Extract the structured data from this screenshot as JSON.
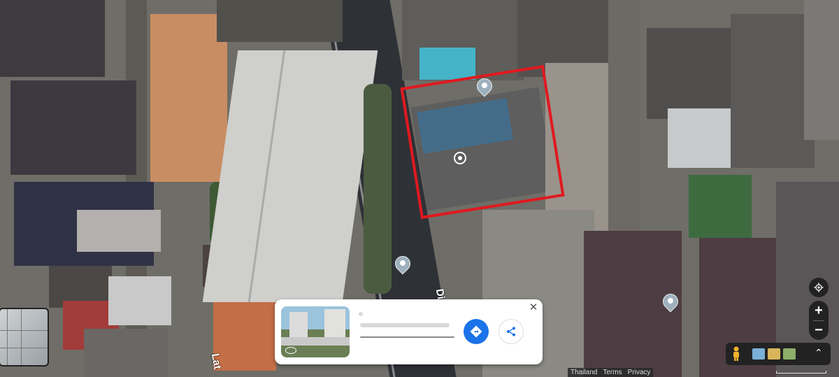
{
  "map": {
    "type": "satellite",
    "accent_color": "#e0191f",
    "road_labels": [
      "Lat",
      "Di"
    ]
  },
  "place_card": {
    "title": "",
    "subtitle": "",
    "directions_icon": "directions-icon",
    "share_icon": "share-icon",
    "close_icon": "close-icon",
    "button_color": "#1a73e8"
  },
  "controls": {
    "zoom_in": "+",
    "zoom_out": "−",
    "expand": "⌃",
    "locate_icon": "my-location-icon",
    "pegman_icon": "pegman-icon"
  },
  "attribution": {
    "items": [
      "Thailand",
      "Terms",
      "Privacy"
    ]
  }
}
